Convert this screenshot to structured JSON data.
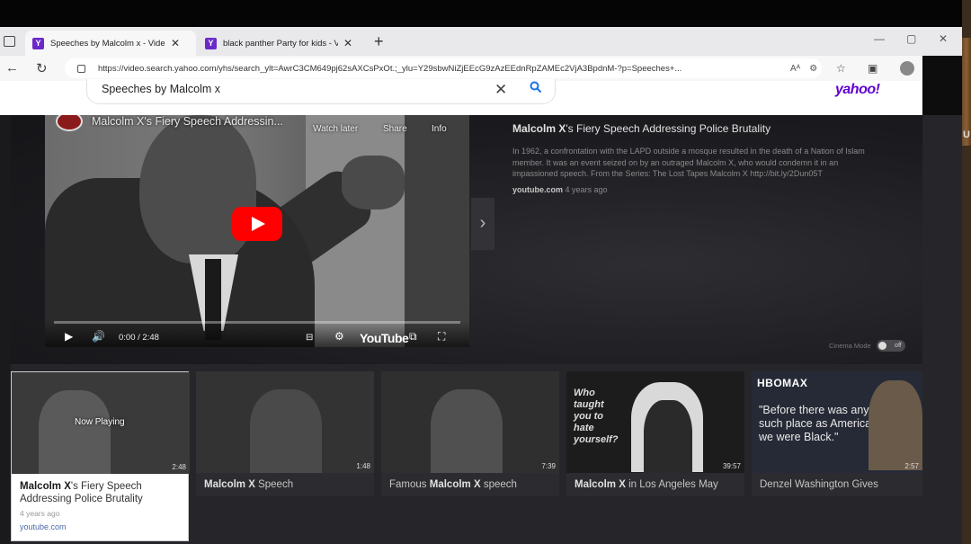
{
  "browser": {
    "tabs": [
      {
        "label": "Speeches by Malcolm x - Video",
        "active": true
      },
      {
        "label": "black panther Party for kids - V",
        "active": false
      }
    ],
    "url": "https://video.search.yahoo.com/yhs/search_ylt=AwrC3CM649pj62sAXCsPxOt.;_ylu=Y29sbwNiZjEEcG9zAzEEdnRpZAMEc2VjA3BpdnM-?p=Speeches+..."
  },
  "search": {
    "query": "Speeches by Malcolm x",
    "brand": "yahoo!"
  },
  "player": {
    "video_title": "Malcolm X's Fiery Speech Addressin...",
    "watch_later": "Watch later",
    "share": "Share",
    "info": "Info",
    "time": "0:00 / 2:48",
    "youtube_label": "YouTube"
  },
  "details": {
    "title_bold": "Malcolm X",
    "title_rest": "'s Fiery Speech Addressing Police Brutality",
    "description": "In 1962, a confrontation with the LAPD outside a mosque resulted in the death of a Nation of Islam member. It was an event seized on by an outraged Malcolm X, who would condemn it in an impassioned speech. From the Series: The Lost Tapes Malcolm X http://bit.ly/2Dun05T",
    "source": "youtube.com",
    "age": "4 years ago",
    "cinema_label": "Cinema Mode",
    "cinema_state": "off"
  },
  "thumbnails": [
    {
      "bold": "Malcolm X",
      "rest": "'s Fiery Speech Addressing Police Brutality",
      "duration": "2:48",
      "now_playing": "Now Playing",
      "age": "4 years ago",
      "source": "youtube.com"
    },
    {
      "bold": "Malcolm X",
      "rest": " Speech",
      "duration": "1:48"
    },
    {
      "pre": "Famous ",
      "bold": "Malcolm X",
      "rest": " speech",
      "duration": "7:39"
    },
    {
      "bold": "Malcolm X",
      "rest": " in Los Angeles May",
      "duration": "39:57",
      "overlay": "Who taught you to hate yourself?"
    },
    {
      "pre": "Denzel Washington Gives",
      "bold": "",
      "rest": "",
      "duration": "2:57",
      "brand": "HBOMAX",
      "quote": "\"Before there was any such place as America, we were Black.\""
    }
  ],
  "right_edge_text": "U"
}
